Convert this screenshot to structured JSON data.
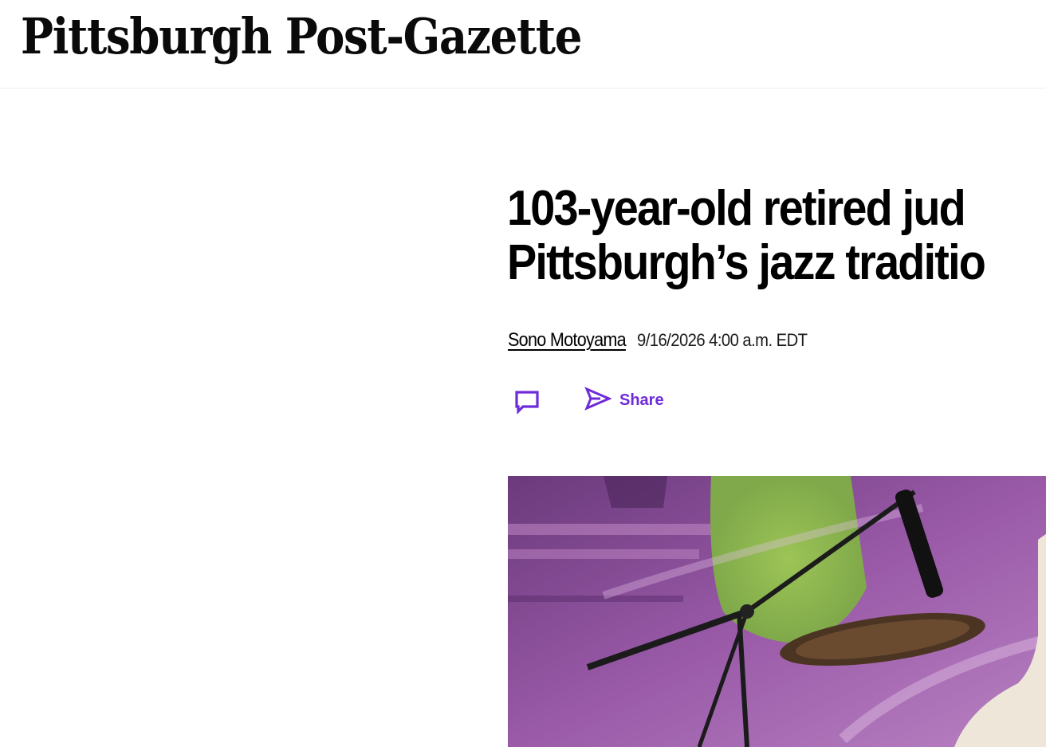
{
  "header": {
    "logo_text": "Pittsburgh Post-Gazette"
  },
  "article": {
    "headline_line1": "103-year-old retired jud",
    "headline_line2": "Pittsburgh’s jazz traditio",
    "author": "Sono Motoyama",
    "timestamp": "9/16/2026 4:00 a.m. EDT"
  },
  "actions": {
    "comment_icon": "comment-icon",
    "share_icon": "share-send-icon",
    "share_label": "Share"
  },
  "colors": {
    "accent": "#6e2bd9",
    "text": "#000000",
    "background": "#ffffff"
  }
}
